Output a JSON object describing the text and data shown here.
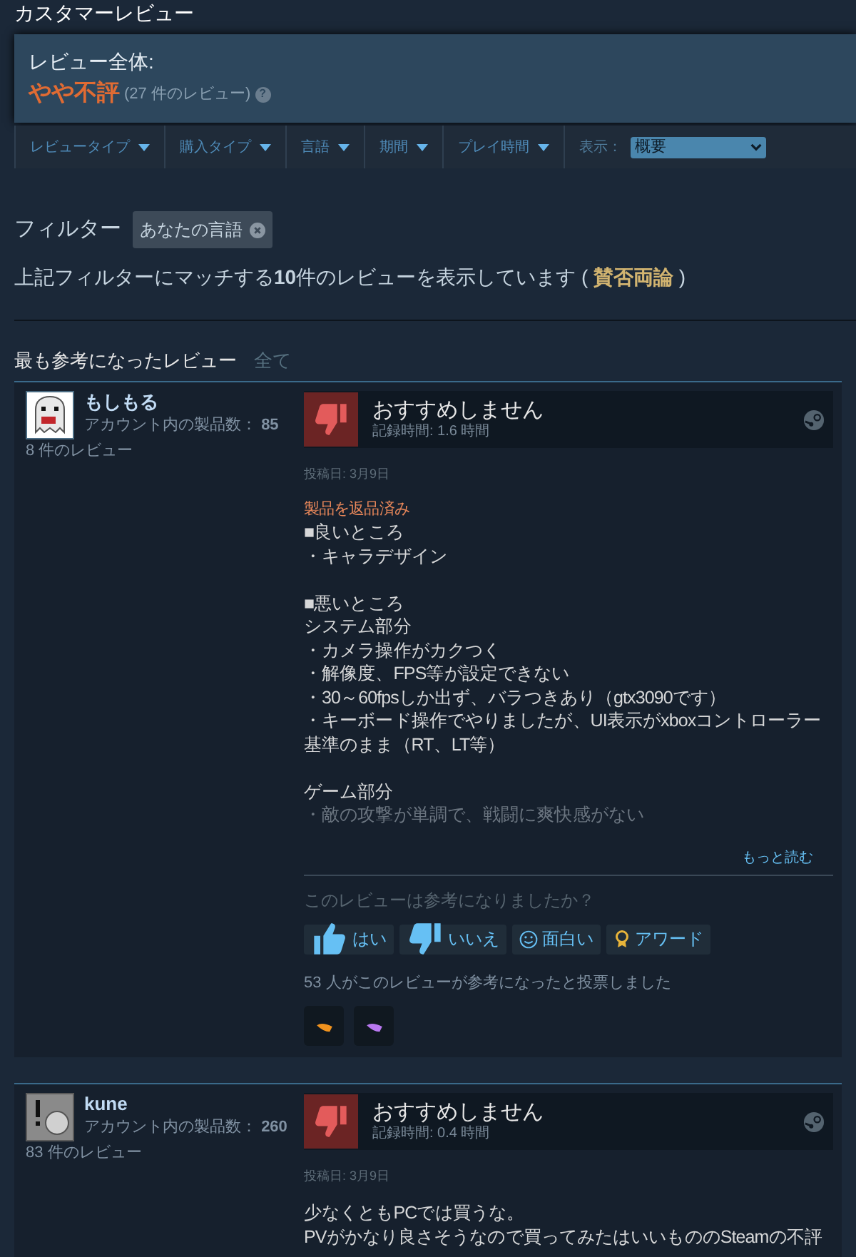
{
  "section_title": "カスタマーレビュー",
  "summary": {
    "label": "レビュー全体:",
    "rating": "やや不評",
    "count": "(27 件のレビュー)",
    "help_icon": "?"
  },
  "filter_bar": {
    "dropdowns": [
      "レビュータイプ",
      "購入タイプ",
      "言語",
      "期間",
      "プレイ時間"
    ],
    "display_label": "表示：",
    "display_value": "概要"
  },
  "filters": {
    "label": "フィルター",
    "chips": [
      "あなたの言語"
    ]
  },
  "match_text": {
    "prefix": "上記フィルターにマッチする**10**件のレビューを表示しています",
    "open": "(",
    "sentiment": "賛否両論",
    "close": ")"
  },
  "most_helpful": {
    "title": "最も参考になったレビュー",
    "all_link": "全て"
  },
  "reviews": [
    {
      "user": {
        "name": "もしもる",
        "products_label": "アカウント内の製品数：",
        "products": "85",
        "reviews_count": "8 件のレビュー"
      },
      "recommended": false,
      "verdict": "おすすめしません",
      "playtime": "記録時間: 1.6 時間",
      "posted": "投稿日: 3月9日",
      "refunded": "製品を返品済み",
      "paragraphs": [
        [
          "■良いところ",
          "・キャラデザイン"
        ],
        [
          "■悪いところ",
          "システム部分",
          "・カメラ操作がカクつく",
          "・解像度、FPS等が設定できない",
          "・30～60fpsしか出ず、バラつきあり（gtx3090です）",
          "・キーボード操作でやりましたが、UI表示がxboxコントローラー基準のまま（RT、LT等）"
        ],
        [
          "ゲーム部分",
          "・敵の攻撃が単調で、戦闘に爽快感がない"
        ]
      ],
      "truncated": true,
      "read_more": "もっと読む",
      "helpful_question": "このレビューは参考になりましたか？",
      "votes": [
        {
          "kind": "yes",
          "label": "はい"
        },
        {
          "kind": "no",
          "label": "いいえ"
        },
        {
          "kind": "funny",
          "label": "面白い"
        },
        {
          "kind": "award",
          "label": "アワード"
        }
      ],
      "helpful_count": "53 人がこのレビューが参考になったと投票しました",
      "awards": [
        {
          "color": "#f0921e"
        },
        {
          "color": "#b978f0"
        }
      ]
    },
    {
      "user": {
        "name": "kune",
        "products_label": "アカウント内の製品数：",
        "products": "260",
        "reviews_count": "83 件のレビュー"
      },
      "recommended": false,
      "verdict": "おすすめしません",
      "playtime": "記録時間: 0.4 時間",
      "posted": "投稿日: 3月9日",
      "paragraphs": [
        [
          "少なくともPCでは買うな。",
          "PVがかなり良さそうなので買ってみたはいいもののSteamの不評"
        ]
      ]
    }
  ]
}
